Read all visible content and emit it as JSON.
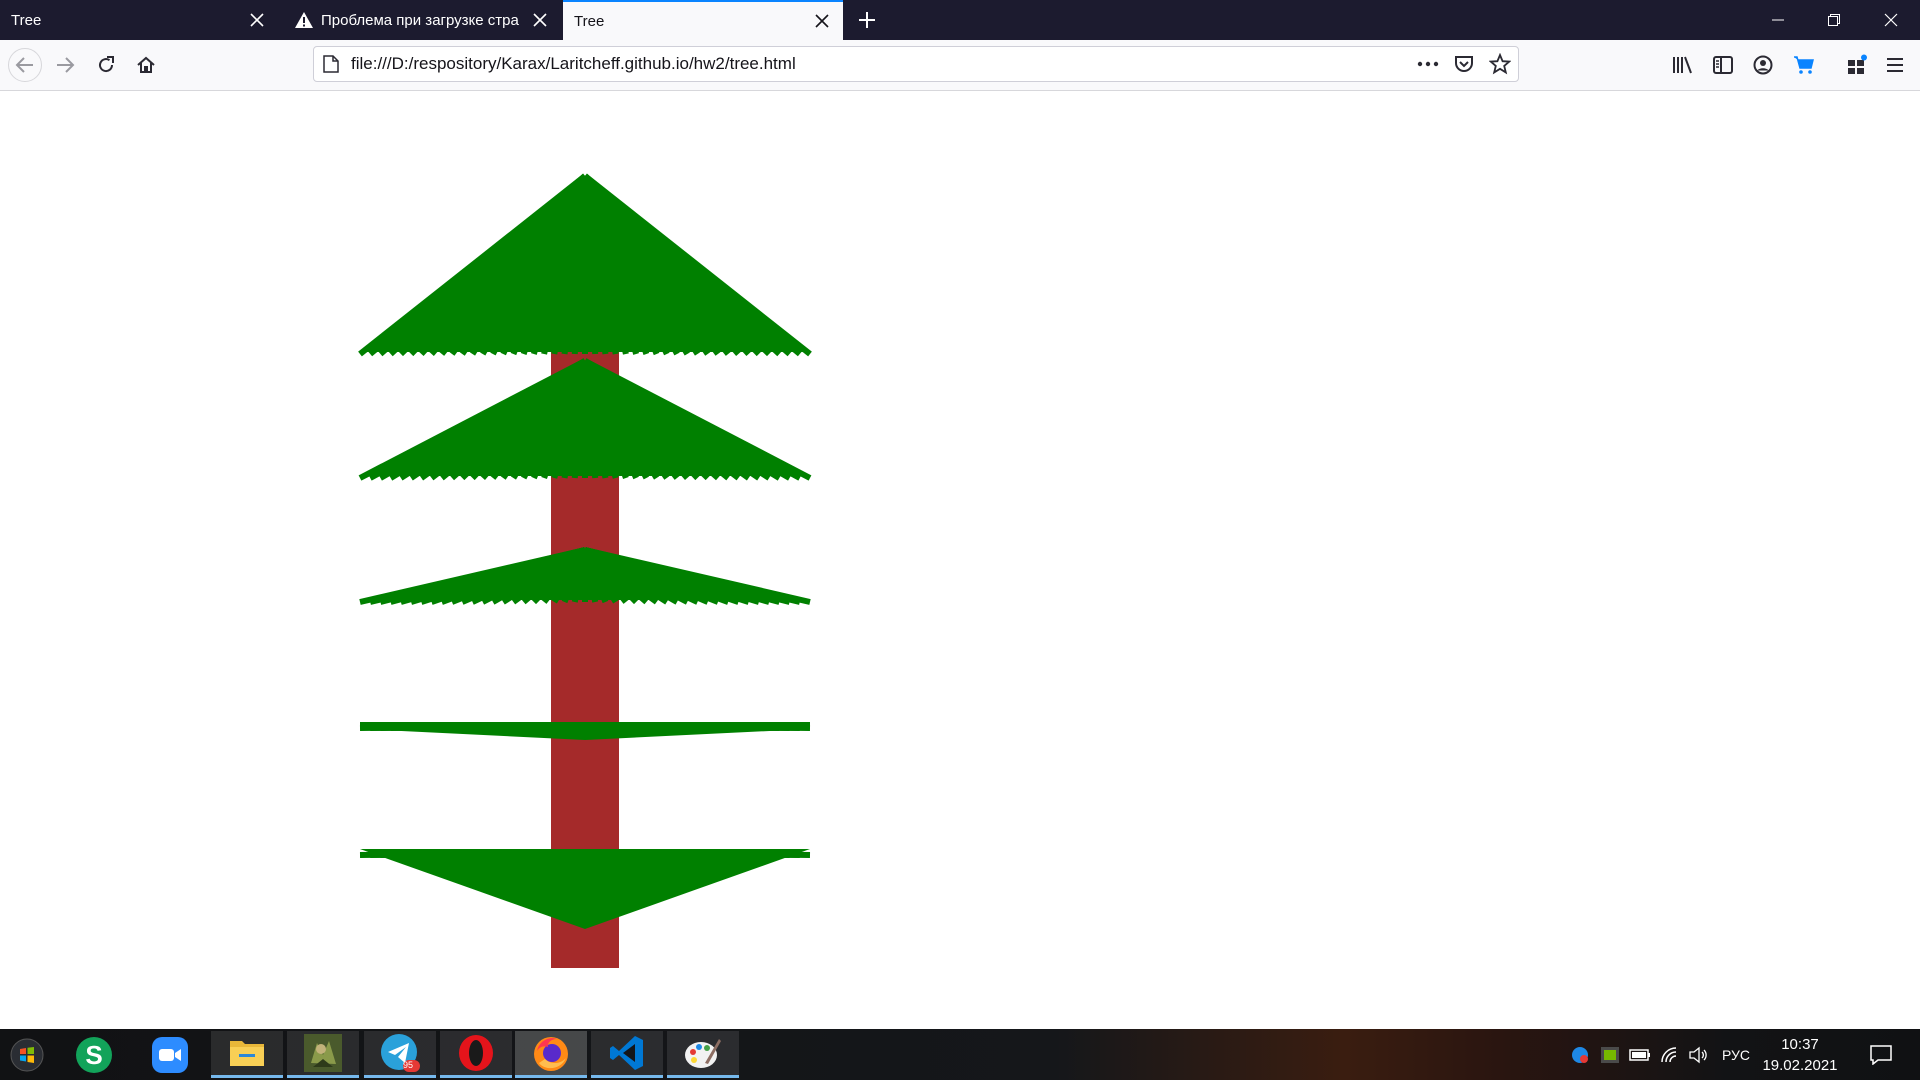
{
  "browser": {
    "tabs": [
      {
        "label": "Tree",
        "active": false
      },
      {
        "label": "Проблема при загрузке стра",
        "active": false,
        "icon": "warning-icon"
      },
      {
        "label": "Tree",
        "active": true
      }
    ],
    "url": "file:///D:/respository/Karax/Laritcheff.github.io/hw2/tree.html"
  },
  "page": {
    "drawing": "tree",
    "colors": {
      "trunk": "#a52a2a",
      "foliage": "#008000"
    },
    "branch_layers": 5
  },
  "taskbar": {
    "apps": [
      "start-icon",
      "skype-icon",
      "zoom-icon",
      "file-explorer-icon",
      "game-icon",
      "telegram-icon",
      "opera-icon",
      "firefox-icon",
      "vscode-icon",
      "paint-icon"
    ],
    "telegram_badge": "95",
    "language": "РУС",
    "time": "10:37",
    "date": "19.02.2021"
  }
}
